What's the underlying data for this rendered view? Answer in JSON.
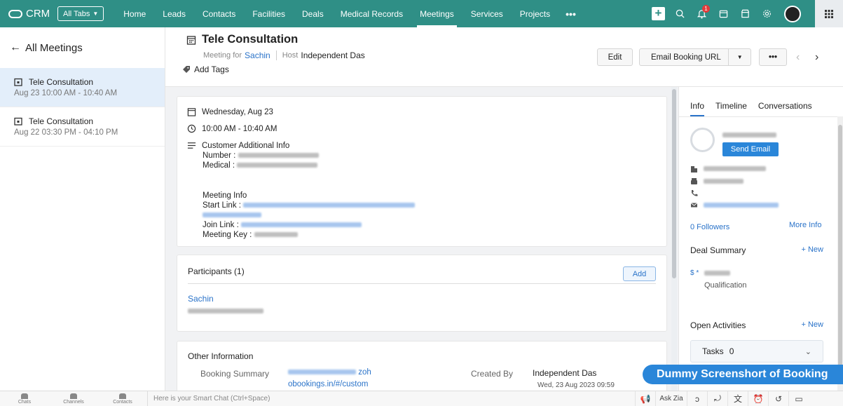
{
  "topbar": {
    "app_name": "CRM",
    "all_tabs_label": "All Tabs",
    "nav": [
      "Home",
      "Leads",
      "Contacts",
      "Facilities",
      "Deals",
      "Medical Records",
      "Meetings",
      "Services",
      "Projects"
    ],
    "active_nav": "Meetings",
    "more_label": "•••",
    "notification_count": "1",
    "accent_color": "#2f8f86"
  },
  "left": {
    "back_label": "All Meetings",
    "meetings": [
      {
        "title": "Tele Consultation",
        "time": "Aug 23 10:00 AM - 10:40 AM"
      },
      {
        "title": "Tele Consultation",
        "time": "Aug 22 03:30 PM - 04:10 PM"
      }
    ]
  },
  "header": {
    "title": "Tele Consultation",
    "meeting_for_label": "Meeting for",
    "meeting_for_value": "Sachin",
    "host_label": "Host",
    "host_value": "Independent Das",
    "add_tags": "Add Tags",
    "edit": "Edit",
    "email_booking": "Email Booking URL",
    "more": "•••"
  },
  "details": {
    "date": "Wednesday, Aug 23",
    "time": "10:00 AM - 10:40 AM",
    "customer_info_title": "Customer Additional Info",
    "number_label": "Number :",
    "medical_label": "Medical :",
    "meeting_info_title": "Meeting Info",
    "start_link_label": "Start Link :",
    "join_link_label": "Join Link :",
    "meeting_key_label": "Meeting Key :"
  },
  "participants": {
    "title": "Participants (1)",
    "add": "Add",
    "name": "Sachin"
  },
  "other": {
    "title": "Other Information",
    "booking_summary_label": "Booking Summary",
    "booking_link_part": "zoh",
    "booking_link_line2": "obookings.in/#/custom",
    "created_by_label": "Created By",
    "created_by_value": "Independent Das",
    "created_on": "Wed, 23 Aug 2023 09:59"
  },
  "right": {
    "tabs": [
      "Info",
      "Timeline",
      "Conversations"
    ],
    "send_email": "Send Email",
    "followers": "0 Followers",
    "more_info": "More Info",
    "deal_summary": "Deal Summary",
    "new": "+ New",
    "stage": "Qualification",
    "open_activities": "Open Activities",
    "tasks_label": "Tasks",
    "tasks_count": "0"
  },
  "watermark": "Dummy Screenshort of Booking",
  "bottom": {
    "items": [
      "Chats",
      "Channels",
      "Contacts"
    ],
    "smartchat_placeholder": "Here is your Smart Chat (Ctrl+Space)",
    "ask_zia": "Ask Zia"
  }
}
